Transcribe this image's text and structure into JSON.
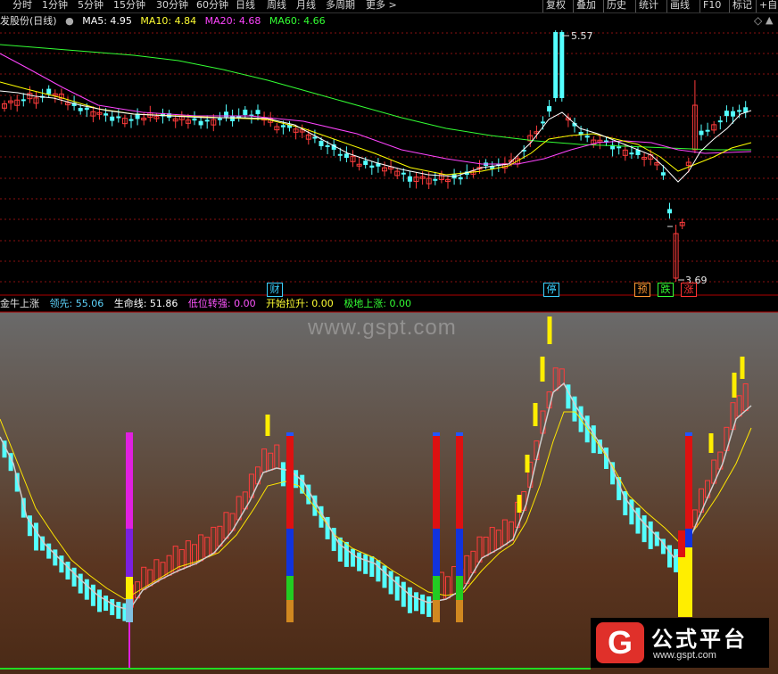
{
  "toolbar": {
    "items": [
      "分时",
      "1分钟",
      "5分钟",
      "15分钟",
      "30分钟",
      "60分钟",
      "日线",
      "周线",
      "月线",
      "多周期",
      "更多 >"
    ],
    "right_items": [
      "复权",
      "叠加",
      "历史",
      "统计",
      "画线",
      "F10",
      "标记",
      "+自"
    ]
  },
  "info": {
    "stock_name": "发股份(日线)",
    "ma5": "MA5: 4.95",
    "ma10": "MA10: 4.84",
    "ma20": "MA20: 4.68",
    "ma60": "MA60: 4.66"
  },
  "annotations": {
    "high": "5.57",
    "low": "3.69",
    "badges": [
      {
        "text": "财",
        "color": "#3ad0ff",
        "bg": "#000"
      },
      {
        "text": "停",
        "color": "#3ad0ff",
        "bg": "#000"
      },
      {
        "text": "预",
        "color": "#ff9933",
        "bg": "#000"
      },
      {
        "text": "跌",
        "color": "#33ff33",
        "bg": "#000"
      },
      {
        "text": "涨",
        "color": "#ff3333",
        "bg": "#000"
      }
    ]
  },
  "sub_indicator": {
    "name": "金牛上涨",
    "lead": "领先: 55.06",
    "life": "生命线: 51.86",
    "low_turn": "低位转强: 0.00",
    "pull_up": "开始拉升: 0.00",
    "bottom_rise": "极地上涨: 0.00"
  },
  "watermark": "www.gspt.com",
  "logo": {
    "mark": "G",
    "title": "公式平台",
    "url": "www.gspt.com"
  },
  "colors": {
    "ma5": "#ffffff",
    "ma10": "#ffff00",
    "ma20": "#ff44ff",
    "ma60": "#33ff33",
    "up": "#ff3c3c",
    "down": "#54ffff",
    "lead_line": "#ffffff",
    "life_line": "#ffe600"
  },
  "chart_data": {
    "type": "line",
    "description_series": [
      "MA5",
      "MA10",
      "MA20",
      "MA60"
    ],
    "price_high": 5.57,
    "price_low": 3.69
  }
}
